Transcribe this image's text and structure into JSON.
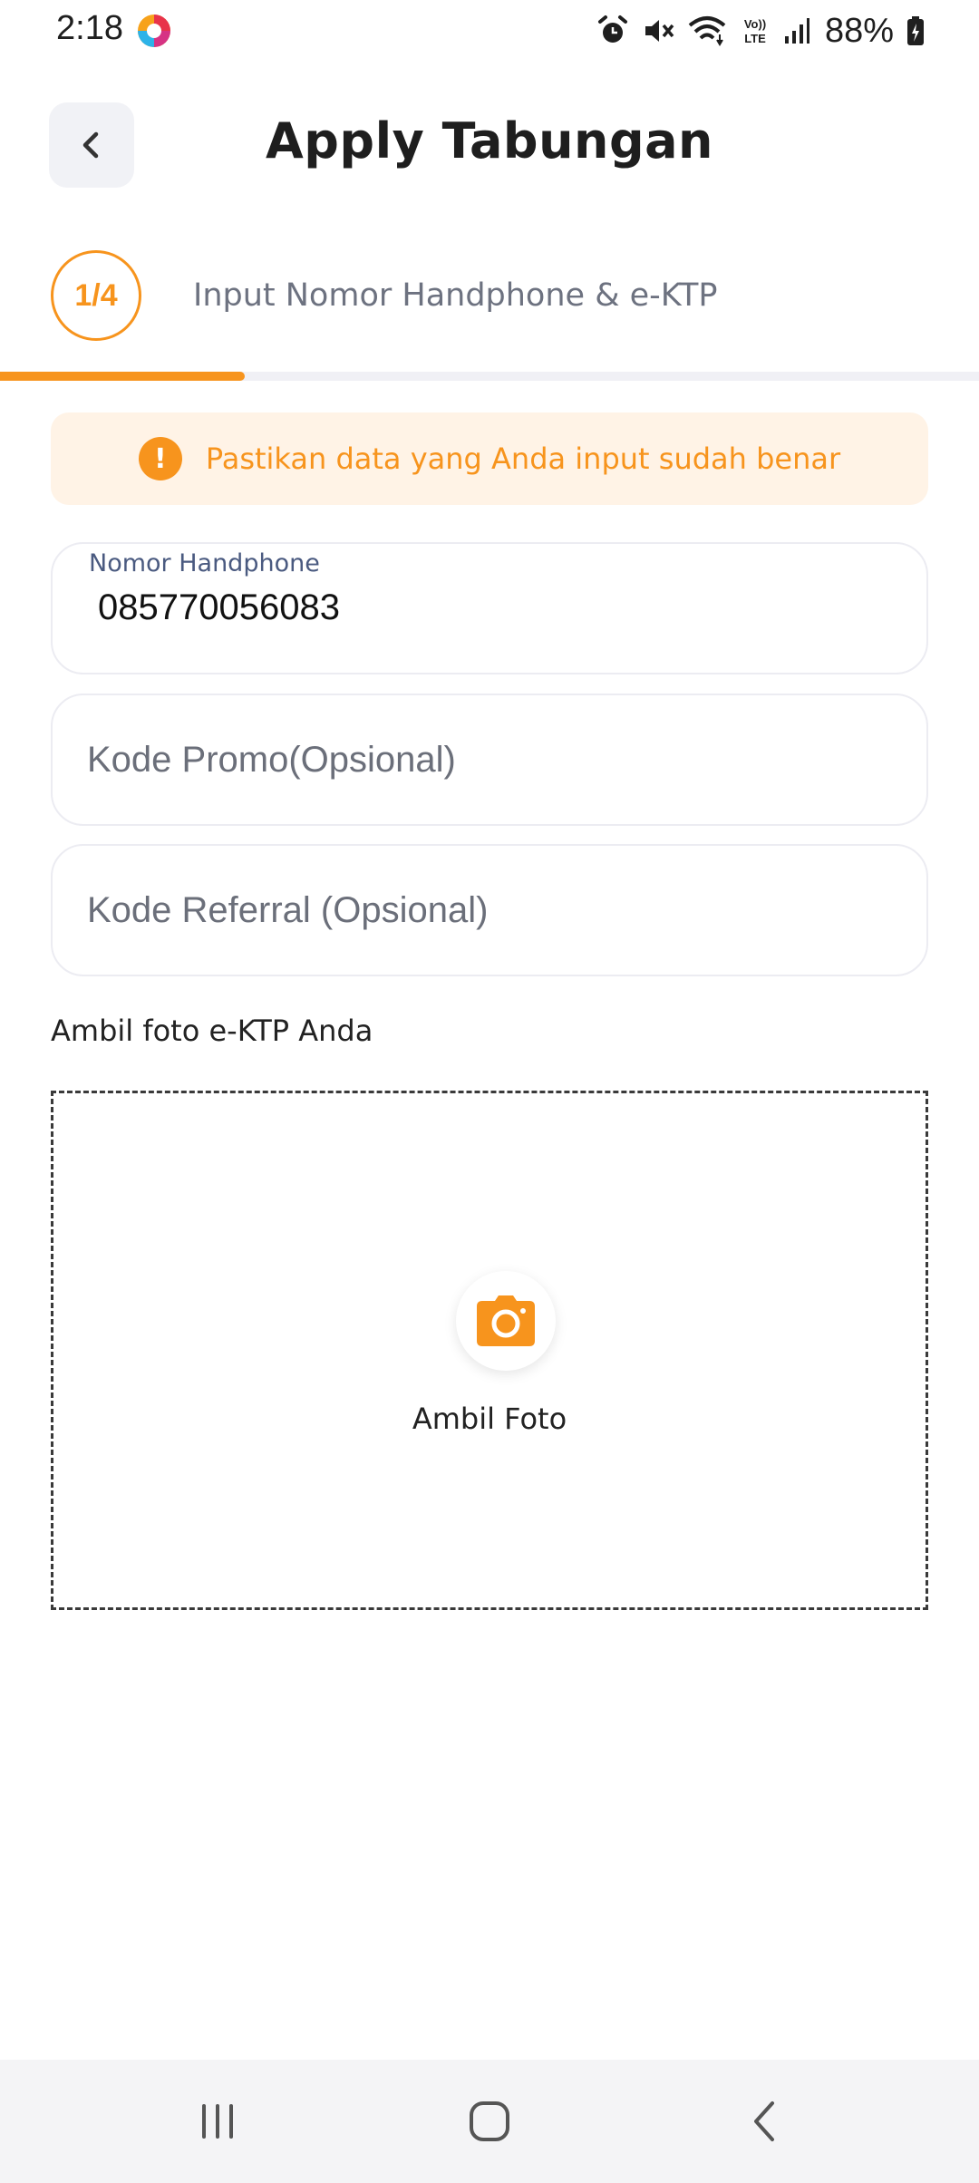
{
  "status_bar": {
    "time": "2:18",
    "battery": "88%",
    "icons": [
      "app-notification-icon",
      "alarm-icon",
      "mute-icon",
      "wifi-icon",
      "volte-icon",
      "signal-icon",
      "battery-icon"
    ]
  },
  "header": {
    "title": "Apply Tabungan",
    "back_icon": "chevron-left-icon"
  },
  "step": {
    "indicator": "1/4",
    "label": "Input Nomor Handphone & e-KTP",
    "progress": 0.25
  },
  "alert": {
    "text": "Pastikan data yang Anda input sudah benar",
    "icon": "exclamation-icon"
  },
  "form": {
    "phone_label": "Nomor Handphone",
    "phone_value": "085770056083",
    "promo_placeholder": "Kode Promo(Opsional)",
    "referral_placeholder": "Kode Referral (Opsional)"
  },
  "photo": {
    "section_label": "Ambil foto e-KTP Anda",
    "button_label": "Ambil Foto",
    "icon": "camera-icon"
  },
  "nav": {
    "icons": [
      "recent-apps-icon",
      "home-icon",
      "back-icon"
    ]
  },
  "colors": {
    "accent": "#f7941d",
    "alert_bg": "#fff3e6",
    "label_blue": "#4a5a80"
  }
}
